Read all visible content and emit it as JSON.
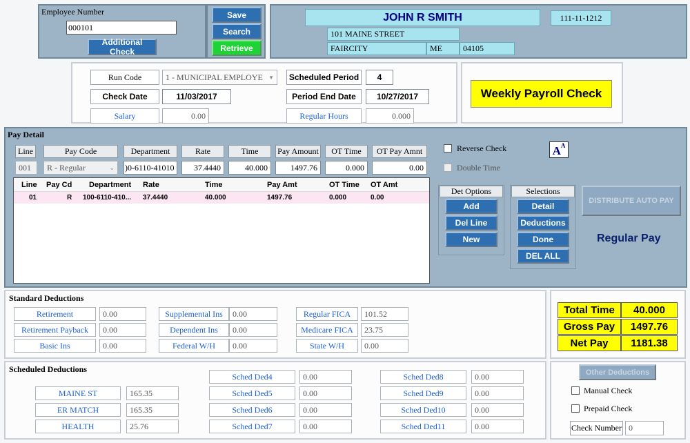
{
  "employee": {
    "number_label": "Employee Number",
    "number_value": "000101",
    "additional_check": "Additional Check"
  },
  "actions": {
    "save": "Save",
    "search": "Search",
    "retrieve": "Retrieve"
  },
  "header": {
    "name": "JOHN R SMITH",
    "ssn": "111-11-1212",
    "street": "101 MAINE STREET",
    "city": "FAIRCITY",
    "state": "ME",
    "zip": "04105"
  },
  "run": {
    "run_code_label": "Run Code",
    "run_code_value": "1 - MUNICIPAL EMPLOYE",
    "scheduled_period_label": "Scheduled Period",
    "scheduled_period_value": "4",
    "check_date_label": "Check Date",
    "check_date_value": "11/03/2017",
    "period_end_label": "Period End Date",
    "period_end_value": "10/27/2017",
    "salary_label": "Salary",
    "salary_value": "0.00",
    "regular_hours_label": "Regular Hours",
    "regular_hours_value": "0.000"
  },
  "check_type": "Weekly Payroll Check",
  "pay_detail": {
    "title": "Pay Detail",
    "headers": {
      "line": "Line",
      "pay_code": "Pay Code",
      "department": "Department",
      "rate": "Rate",
      "time": "Time",
      "pay_amount": "Pay Amount",
      "ot_time": "OT Time",
      "ot_pay_amnt": "OT Pay Amnt"
    },
    "edit": {
      "line": "001",
      "pay_code": "R - Regular",
      "department": ")0-6110-41010",
      "rate": "37.4440",
      "time": "40.000",
      "pay_amount": "1497.76",
      "ot_time": "0.000",
      "ot_pay_amnt": "0.00"
    },
    "reverse_check": "Reverse Check",
    "double_time": "Double Time",
    "font_icon": "AA",
    "grid_headers": {
      "line": "Line",
      "pay_cd": "Pay Cd",
      "department": "Department",
      "rate": "Rate",
      "time": "Time",
      "pay_amt": "Pay Amt",
      "ot_time": "OT Time",
      "ot_amt": "OT Amt"
    },
    "rows": [
      {
        "line": "01",
        "pay_cd": "R",
        "department": "100-6110-410...",
        "rate": "37.4440",
        "time": "40.000",
        "pay_amt": "1497.76",
        "ot_time": "0.000",
        "ot_amt": "0.00"
      }
    ],
    "det_options": {
      "title": "Det Options",
      "add": "Add",
      "del_line": "Del Line",
      "new": "New"
    },
    "selections": {
      "title": "Selections",
      "detail": "Detail",
      "deductions": "Deductions",
      "done": "Done",
      "del_all": "DEL ALL"
    },
    "distribute": "DISTRIBUTE AUTO PAY",
    "regular_pay": "Regular Pay"
  },
  "standard_deductions": {
    "title": "Standard Deductions",
    "retirement": {
      "label": "Retirement",
      "value": "0.00"
    },
    "retirement_payback": {
      "label": "Retirement Payback",
      "value": "0.00"
    },
    "basic_ins": {
      "label": "Basic Ins",
      "value": "0.00"
    },
    "supplemental_ins": {
      "label": "Supplemental Ins",
      "value": "0.00"
    },
    "dependent_ins": {
      "label": "Dependent Ins",
      "value": "0.00"
    },
    "federal_wh": {
      "label": "Federal W/H",
      "value": "0.00"
    },
    "regular_fica": {
      "label": "Regular FICA",
      "value": "101.52"
    },
    "medicare_fica": {
      "label": "Medicare FICA",
      "value": "23.75"
    },
    "state_wh": {
      "label": "State W/H",
      "value": "0.00"
    }
  },
  "totals": {
    "total_time_label": "Total Time",
    "total_time_value": "40.000",
    "gross_pay_label": "Gross Pay",
    "gross_pay_value": "1497.76",
    "net_pay_label": "Net Pay",
    "net_pay_value": "1181.38"
  },
  "scheduled_deductions": {
    "title": "Scheduled Deductions",
    "maine_st": {
      "label": "MAINE ST",
      "value": "165.35"
    },
    "er_match": {
      "label": "ER MATCH",
      "value": "165.35"
    },
    "health": {
      "label": "HEALTH",
      "value": "25.76"
    },
    "d4": {
      "label": "Sched Ded4",
      "value": "0.00"
    },
    "d5": {
      "label": "Sched Ded5",
      "value": "0.00"
    },
    "d6": {
      "label": "Sched Ded6",
      "value": "0.00"
    },
    "d7": {
      "label": "Sched Ded7",
      "value": "0.00"
    },
    "d8": {
      "label": "Sched Ded8",
      "value": "0.00"
    },
    "d9": {
      "label": "Sched Ded9",
      "value": "0.00"
    },
    "d10": {
      "label": "Sched Ded10",
      "value": "0.00"
    },
    "d11": {
      "label": "Sched Ded11",
      "value": "0.00"
    }
  },
  "other": {
    "other_deductions": "Other Deductions",
    "manual_check": "Manual Check",
    "prepaid_check": "Prepaid Check",
    "check_number_label": "Check Number",
    "check_number_value": "0"
  },
  "colors": {
    "panel": "#9db4c7",
    "button": "#2d6fb0",
    "retrieve": "#1fd336",
    "highlight": "#ffff00",
    "label_blue": "#1d5fd6",
    "header_cyan": "#a8e4f0"
  }
}
